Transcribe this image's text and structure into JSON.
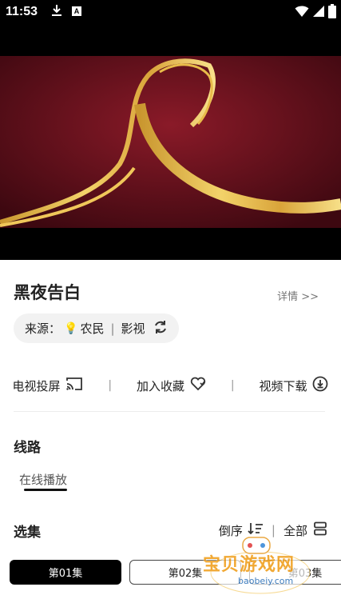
{
  "status_bar": {
    "time": "11:53",
    "notif_a": "A"
  },
  "video": {
    "bg_top": "#7a1420",
    "bg_bottom": "#3d0810",
    "ribbon_color": "#e3b34a"
  },
  "details_label": "详情 >>",
  "title": "黑夜告白",
  "source": {
    "label": "来源：",
    "name": "农民",
    "divider": "|",
    "type": "影视"
  },
  "actions": {
    "tv_cast": "电视投屏",
    "favorite": "加入收藏",
    "download": "视频下载",
    "sep": "|"
  },
  "route": {
    "title": "线路",
    "tab": "在线播放"
  },
  "episodes_section": {
    "title": "选集",
    "sort_label": "倒序",
    "all_label": "全部",
    "sep": "|",
    "items": [
      {
        "label": "第01集",
        "active": true
      },
      {
        "label": "第02集",
        "active": false
      },
      {
        "label": "第03集",
        "active": false
      }
    ]
  },
  "watermark": {
    "text": "宝贝游戏网",
    "url": "baobeiy.com"
  }
}
